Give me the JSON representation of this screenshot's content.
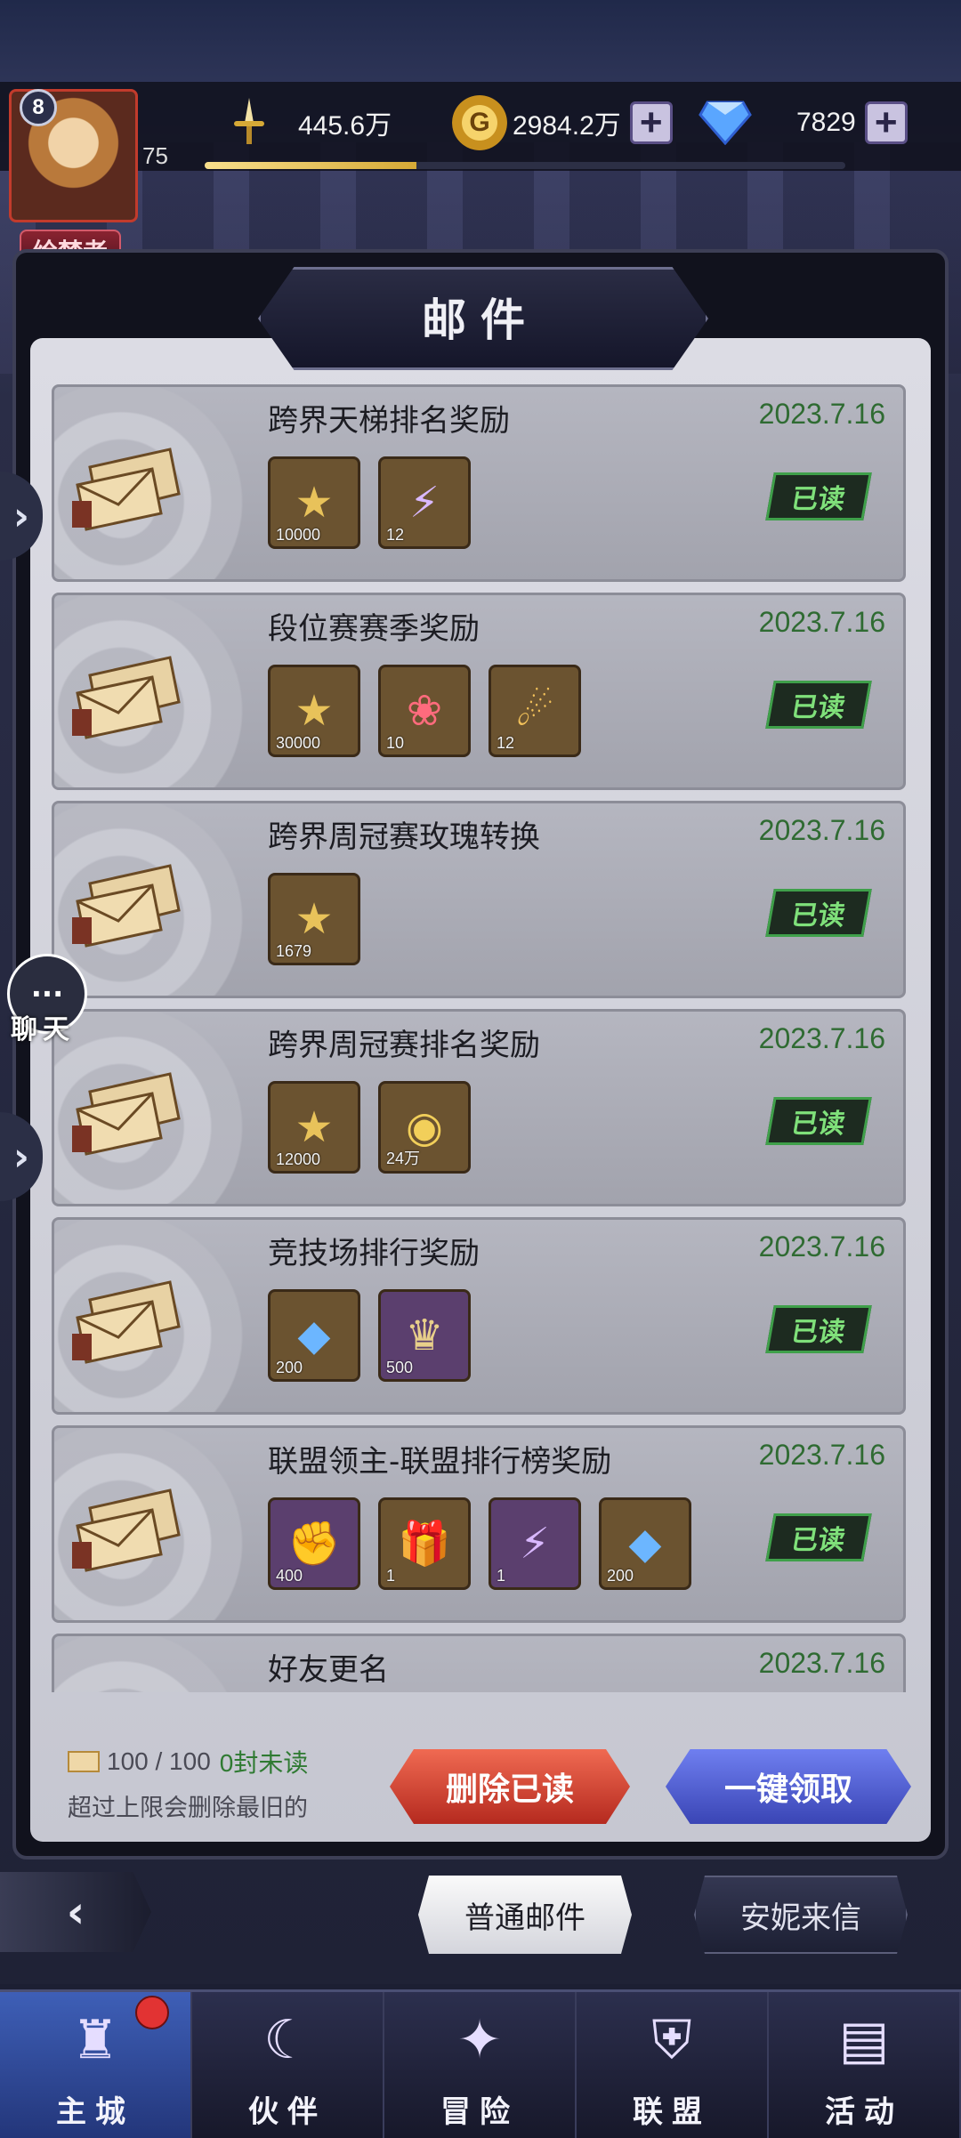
{
  "player": {
    "level": "8",
    "num": "75",
    "title": "绘梦者",
    "exp_fraction": 0.33
  },
  "currencies": {
    "power": "445.6万",
    "gold": "2984.2万",
    "gems": "7829"
  },
  "window": {
    "title": "邮件"
  },
  "mails": [
    {
      "title": "跨界天梯排名奖励",
      "date": "2023.7.16",
      "status": "已读",
      "items": [
        {
          "icon": "medal-icon",
          "count": "10000",
          "tint": "gold"
        },
        {
          "icon": "lightning-token-icon",
          "count": "12",
          "tint": "gold"
        }
      ]
    },
    {
      "title": "段位赛赛季奖励",
      "date": "2023.7.16",
      "status": "已读",
      "items": [
        {
          "icon": "medal-icon",
          "count": "30000",
          "tint": "gold"
        },
        {
          "icon": "rose-icon",
          "count": "10",
          "tint": "gold"
        },
        {
          "icon": "dragon-egg-icon",
          "count": "12",
          "tint": "gold"
        }
      ]
    },
    {
      "title": "跨界周冠赛玫瑰转换",
      "date": "2023.7.16",
      "status": "已读",
      "items": [
        {
          "icon": "medal-icon",
          "count": "1679",
          "tint": "gold"
        }
      ]
    },
    {
      "title": "跨界周冠赛排名奖励",
      "date": "2023.7.16",
      "status": "已读",
      "items": [
        {
          "icon": "medal-icon",
          "count": "12000",
          "tint": "gold"
        },
        {
          "icon": "gold-coin-icon",
          "count": "24万",
          "tint": "gold"
        }
      ]
    },
    {
      "title": "竞技场排行奖励",
      "date": "2023.7.16",
      "status": "已读",
      "items": [
        {
          "icon": "diamond-icon",
          "count": "200",
          "tint": "gold"
        },
        {
          "icon": "crest-icon",
          "count": "500",
          "tint": "purple"
        }
      ]
    },
    {
      "title": "联盟领主-联盟排行榜奖励",
      "date": "2023.7.16",
      "status": "已读",
      "items": [
        {
          "icon": "fist-coin-icon",
          "count": "400",
          "tint": "purple"
        },
        {
          "icon": "gift-boxes-icon",
          "count": "1",
          "tint": "gold"
        },
        {
          "icon": "lightning-token-icon",
          "count": "1",
          "tint": "purple"
        },
        {
          "icon": "diamond-icon",
          "count": "200",
          "tint": "gold"
        }
      ]
    },
    {
      "title": "好友更名",
      "date": "2023.7.16",
      "status": "",
      "items": []
    }
  ],
  "footer": {
    "count": "100 / 100",
    "unread": "0封未读",
    "note": "超过上限会删除最旧的",
    "delete_read": "删除已读",
    "claim_all": "一键领取"
  },
  "chat": {
    "label": "聊天",
    "icon": "chat-bubble-icon"
  },
  "tabs": {
    "normal": "普通邮件",
    "annie": "安妮来信"
  },
  "nav": [
    {
      "label": "主城",
      "icon": "castle-icon",
      "active": true,
      "badge": true
    },
    {
      "label": "伙伴",
      "icon": "witch-hat-icon",
      "active": false,
      "badge": false
    },
    {
      "label": "冒险",
      "icon": "compass-icon",
      "active": false,
      "badge": false
    },
    {
      "label": "联盟",
      "icon": "shield-icon",
      "active": false,
      "badge": false
    },
    {
      "label": "活动",
      "icon": "cards-icon",
      "active": false,
      "badge": false
    }
  ]
}
